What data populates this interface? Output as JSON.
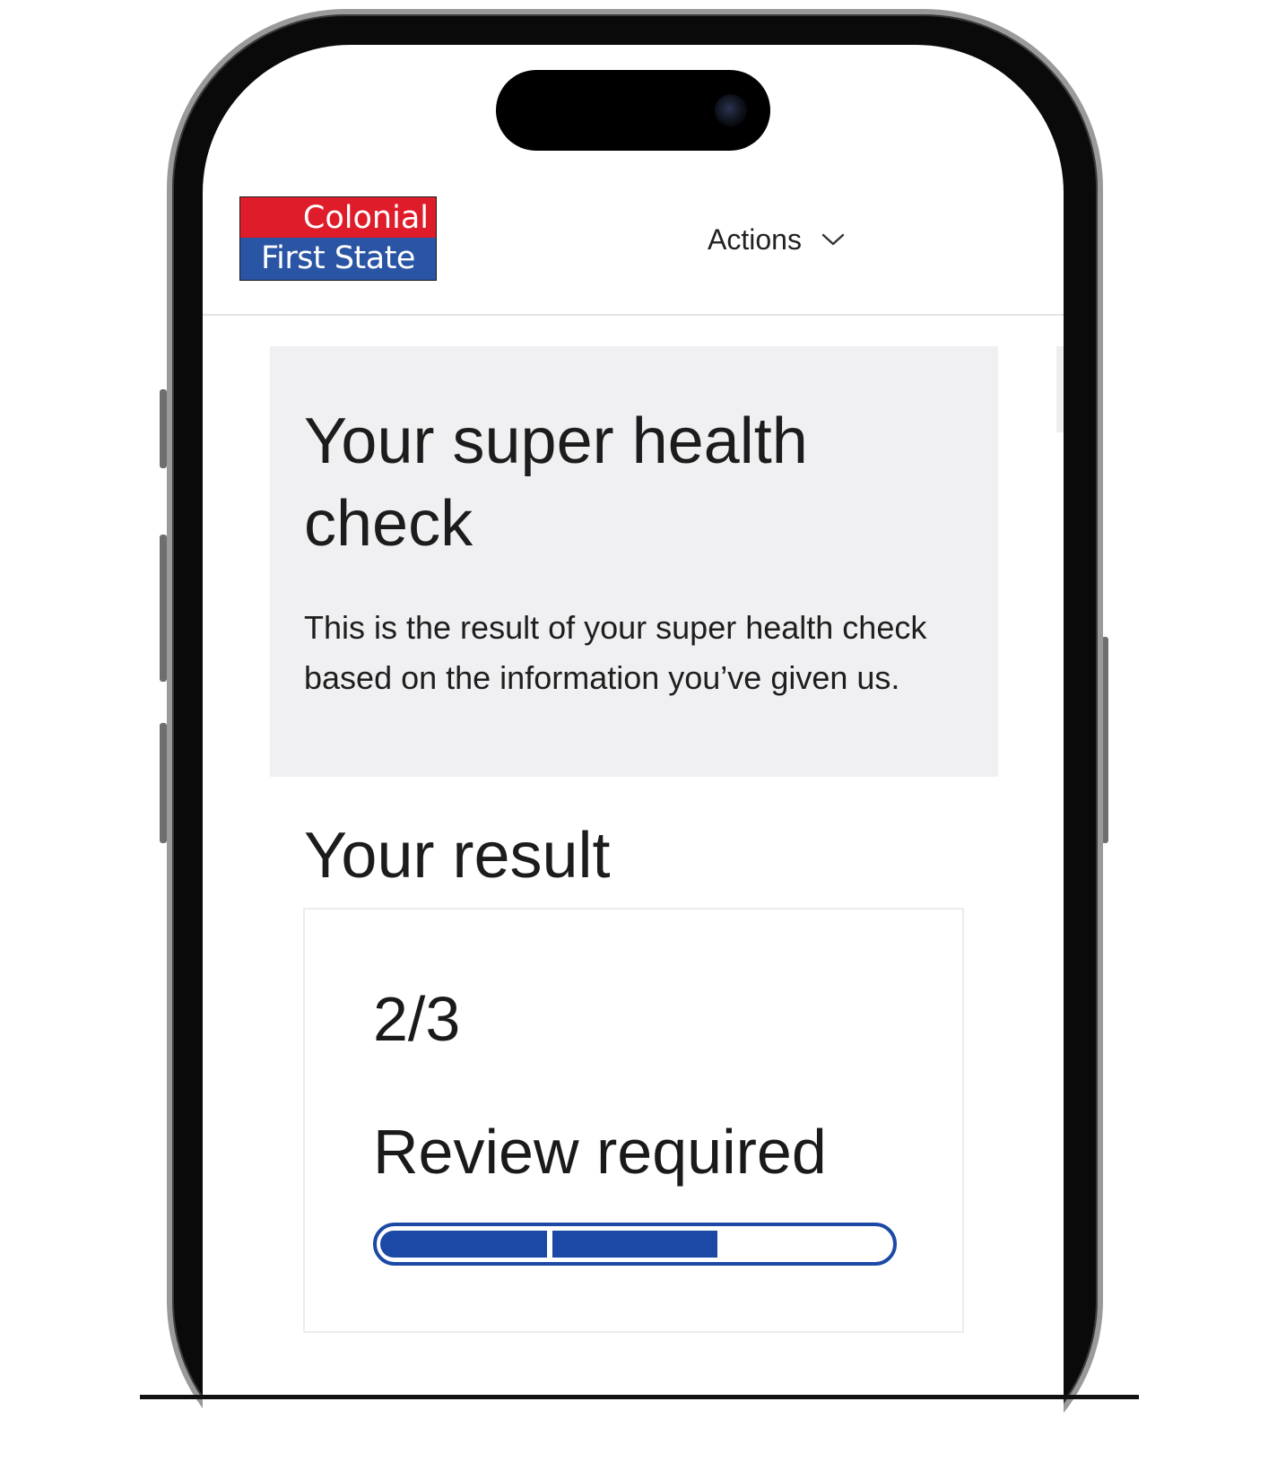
{
  "header": {
    "logo": {
      "line1": "Colonial",
      "line2": "First State"
    },
    "actions_label": "Actions"
  },
  "hero": {
    "title": "Your super health check",
    "description": "This is the result of your super health check based on the information you’ve given us."
  },
  "result": {
    "heading": "Your result",
    "score": "2/3",
    "status": "Review required",
    "progress": {
      "filled_segments": 2,
      "total_segments": 3
    }
  },
  "colors": {
    "brand_red": "#df1d2a",
    "brand_blue": "#2a54a4",
    "progress_blue": "#1c49a5",
    "hero_background": "#f0eff1"
  },
  "icons": {
    "actions_chevron": "chevron-down-icon"
  }
}
